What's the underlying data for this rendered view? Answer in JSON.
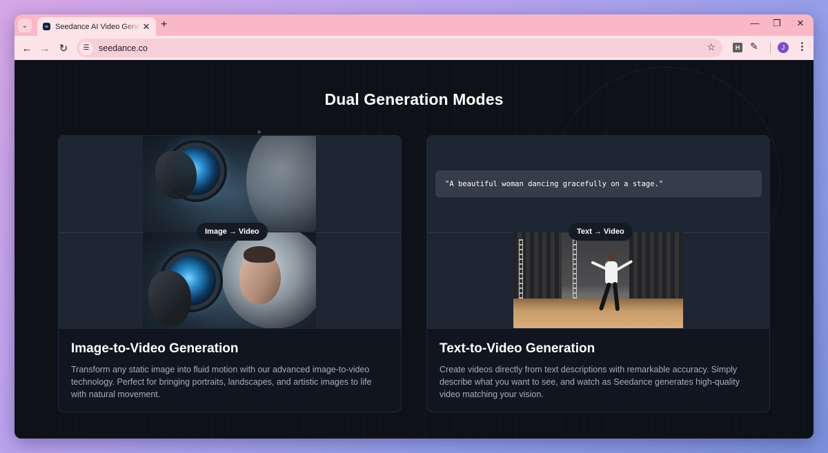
{
  "browser": {
    "tab_title": "Seedance AI Video Generator - ",
    "url": "seedance.co",
    "profile_initial": "J",
    "extension_label": "H"
  },
  "page": {
    "section_title": "Dual Generation Modes",
    "cards": [
      {
        "badge": "Image → Video",
        "title": "Image-to-Video Generation",
        "description": "Transform any static image into fluid motion with our advanced image-to-video technology. Perfect for bringing portraits, landscapes, and artistic images to life with natural movement."
      },
      {
        "badge": "Text → Video",
        "prompt": "\"A beautiful woman dancing gracefully on a stage.\"",
        "title": "Text-to-Video Generation",
        "description": "Create videos directly from text descriptions with remarkable accuracy. Simply describe what you want to see, and watch as Seedance generates high-quality video matching your vision."
      }
    ]
  },
  "colors": {
    "page_bg": "#0e1117",
    "card_bg": "#111520",
    "media_bg": "#1e2633",
    "tab_strip": "#f9b8c6",
    "toolbar": "#fde4ea"
  }
}
